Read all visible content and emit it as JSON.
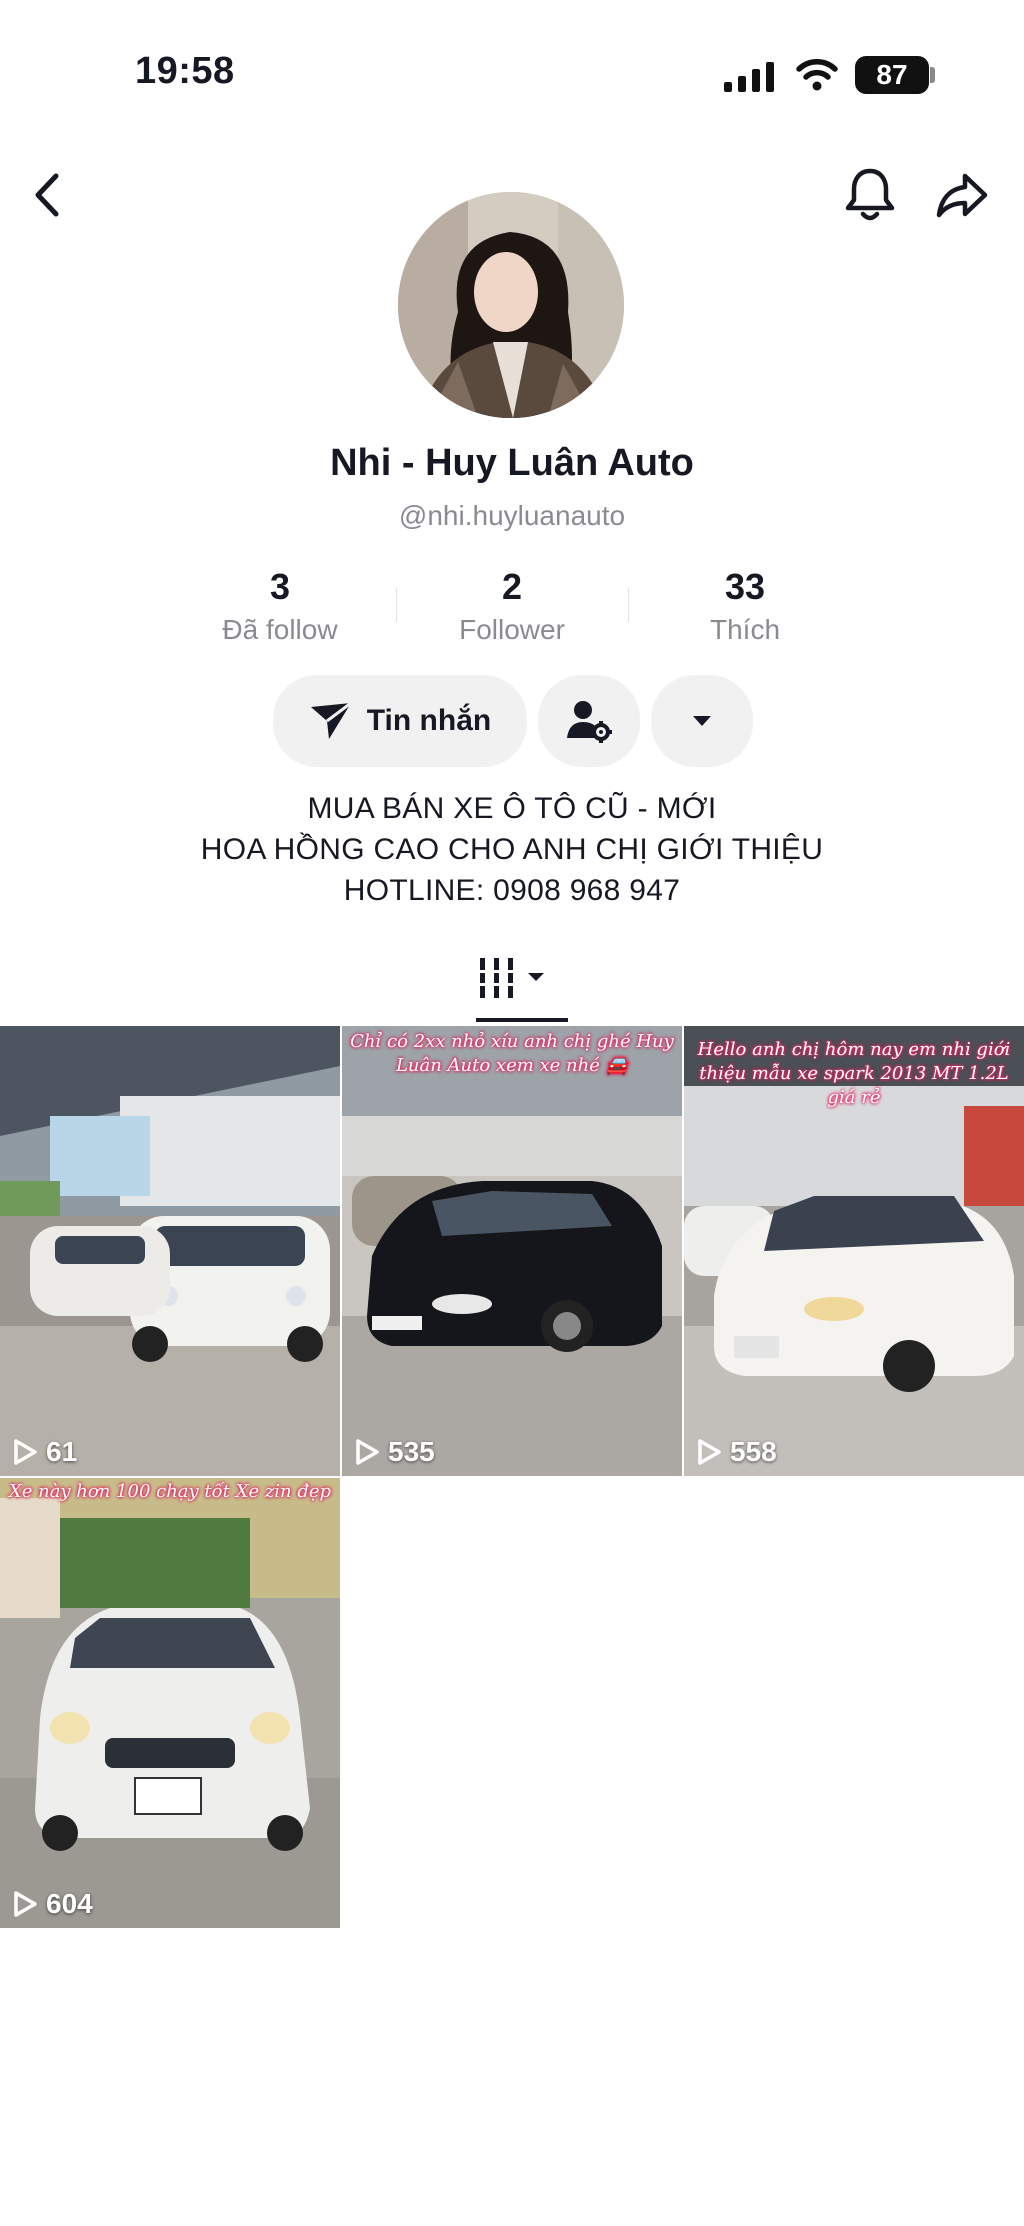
{
  "status_bar": {
    "time": "19:58",
    "battery": "87"
  },
  "profile": {
    "display_name": "Nhi - Huy Luân Auto",
    "handle": "@nhi.huyluanauto",
    "stats": [
      {
        "value": "3",
        "label": "Đã follow"
      },
      {
        "value": "2",
        "label": "Follower"
      },
      {
        "value": "33",
        "label": "Thích"
      }
    ],
    "message_button": "Tin nhắn",
    "bio": [
      "MUA BÁN XE Ô TÔ CŨ - MỚI",
      "HOA HỒNG CAO CHO ANH CHỊ GIỚI THIỆU",
      "HOTLINE: 0908 968 947"
    ]
  },
  "videos": [
    {
      "views": "61",
      "caption": "",
      "car_color": "#f2f2ee"
    },
    {
      "views": "535",
      "caption": "Chỉ có 2xx nhỏ xíu anh chị ghé Huy Luân Auto xem xe nhé 🚘",
      "car_color": "#15161b"
    },
    {
      "views": "558",
      "caption": "Hello anh chị hôm nay em nhi giới thiệu mẫu xe spark 2013 MT 1.2L giá rẻ",
      "car_color": "#f4f3ef"
    },
    {
      "views": "604",
      "caption": "Xe này hơn 100 chạy tốt Xe zin đẹp",
      "car_color": "#eeeeec"
    }
  ],
  "colors": {
    "text": "#161823",
    "muted": "#8a8b91",
    "button_bg": "#f1f1f2",
    "caption_glow": "#e0245e"
  }
}
